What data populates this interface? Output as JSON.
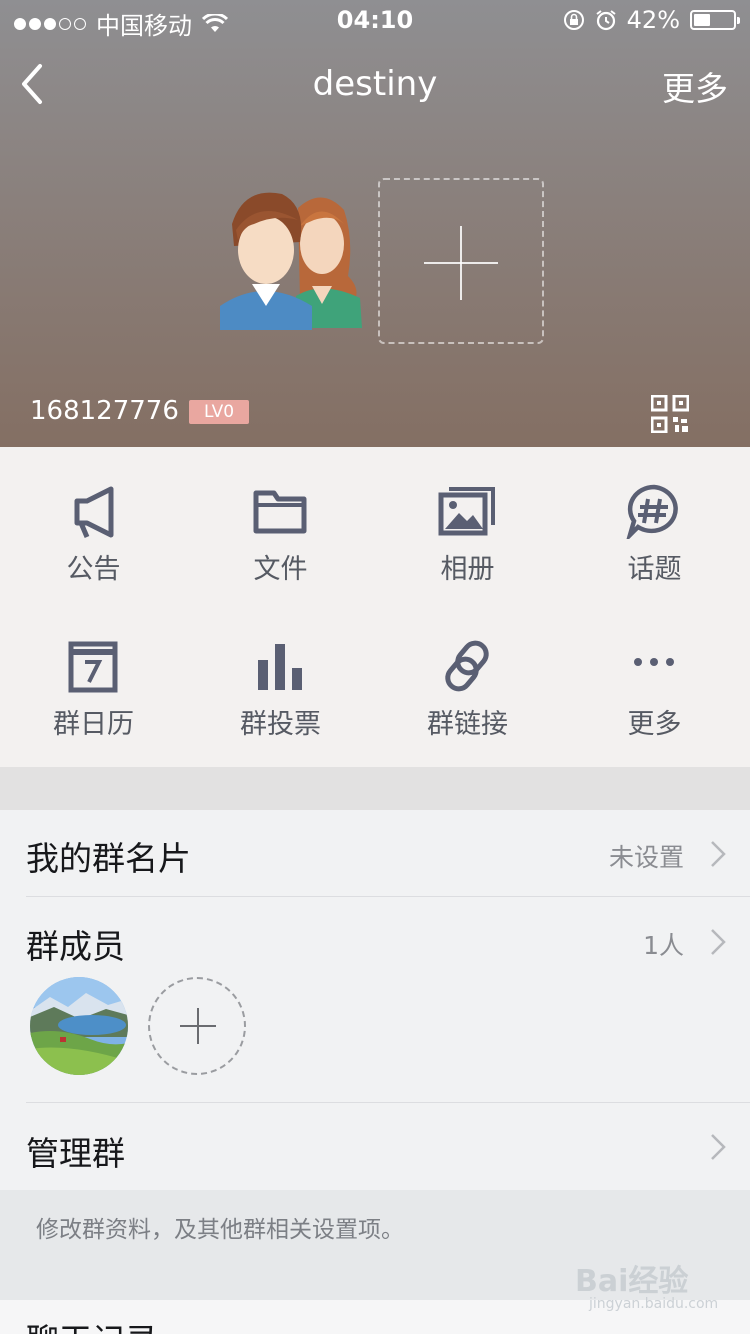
{
  "status_bar": {
    "carrier": "中国移动",
    "time": "04:10",
    "battery": "42%"
  },
  "nav": {
    "title": "destiny",
    "more_label": "更多"
  },
  "group": {
    "id": "168127776",
    "level": "LV0"
  },
  "grid": {
    "items": [
      {
        "label": "公告",
        "icon": "megaphone-icon"
      },
      {
        "label": "文件",
        "icon": "folder-icon"
      },
      {
        "label": "相册",
        "icon": "photo-album-icon"
      },
      {
        "label": "话题",
        "icon": "topic-hash-icon"
      },
      {
        "label": "群日历",
        "icon": "calendar-icon"
      },
      {
        "label": "群投票",
        "icon": "bar-chart-icon"
      },
      {
        "label": "群链接",
        "icon": "link-icon"
      },
      {
        "label": "更多",
        "icon": "more-dots-icon"
      }
    ]
  },
  "rows": {
    "card": {
      "label": "我的群名片",
      "value": "未设置"
    },
    "members": {
      "label": "群成员",
      "value": "1人"
    },
    "manage": {
      "label": "管理群",
      "description": "修改群资料，及其他群相关设置项。"
    },
    "history": {
      "label": "聊天记录"
    }
  },
  "watermark": {
    "text": "Bai经验",
    "url": "jingyan.baidu.com"
  },
  "colors": {
    "icon": "#5a5f73",
    "lv_badge": "#e9a7a0"
  }
}
